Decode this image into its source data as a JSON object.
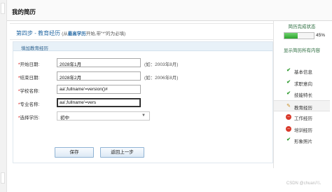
{
  "page": {
    "title": "我的简历"
  },
  "step": {
    "title": "第四步 - 教育经历",
    "hint_prefix": "(从",
    "hint_bold": "最高学历",
    "hint_suffix": "开始,带\"*\"的为必填)"
  },
  "card": {
    "header": "填加教育经历"
  },
  "form": {
    "required_mark": "*",
    "fields": [
      {
        "label": "开始日期:",
        "value": "2028年1月",
        "hint": "(如：2003年8月)"
      },
      {
        "label": "结束日期:",
        "value": "2028年2月",
        "hint": "(如：2006年8月)"
      },
      {
        "label": "学校名称:",
        "value": "aa',fullname'=version()#",
        "hint": ""
      },
      {
        "label": "专业名称:",
        "value": "aa',fullname'=vers",
        "hint": ""
      },
      {
        "label": "选择学历:",
        "value": "初中",
        "hint": ""
      }
    ],
    "select_caret": "▼"
  },
  "buttons": {
    "save": "保存",
    "back": "返回上一步"
  },
  "sidebar": {
    "title": "简历完成状态",
    "progress_percent": 45,
    "progress_label": "45%",
    "show_all": "显示简历所有内容",
    "items": [
      {
        "label": "基本信息",
        "status": "done",
        "icon": "check-icon",
        "glyph": "✔"
      },
      {
        "label": "求职意向",
        "status": "done",
        "icon": "check-icon",
        "glyph": "✔"
      },
      {
        "label": "技能特长",
        "status": "done",
        "icon": "check-icon",
        "glyph": "✔"
      },
      {
        "label": "教育经历",
        "status": "editing",
        "icon": "pencil-icon",
        "glyph": "✎"
      },
      {
        "label": "工作经历",
        "status": "missing",
        "icon": "no-entry-icon",
        "glyph": "–"
      },
      {
        "label": "培训经历",
        "status": "missing",
        "icon": "no-entry-icon",
        "glyph": "–"
      },
      {
        "label": "形象照片",
        "status": "done",
        "icon": "check-icon",
        "glyph": "✔"
      }
    ]
  },
  "watermark": "CSDN @chuan川、"
}
